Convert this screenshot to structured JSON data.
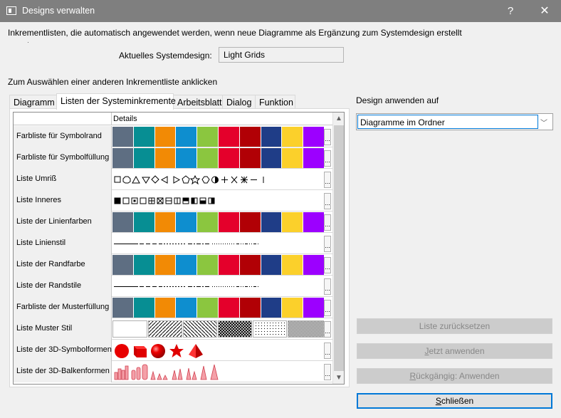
{
  "window": {
    "title": "Designs verwalten",
    "help_glyph": "?",
    "close_glyph": "✕",
    "icon": "window-icon"
  },
  "intro": "Inkrementlisten, die automatisch angewendet werden, wenn neue Diagramme als Ergänzung zum Systemdesign erstellt",
  "intro_mark": "·",
  "system_design": {
    "label": "Aktuelles Systemdesign:",
    "value": "Light Grids"
  },
  "hint": "Zum Auswählen einer anderen Inkrementliste anklicken",
  "tabs": [
    "Diagramm",
    "Listen der Systeminkremente",
    "Arbeitsblatt",
    "Dialog",
    "Funktion"
  ],
  "active_tab": 1,
  "grid": {
    "column_header": "Details",
    "ellipsis": "...",
    "palette": [
      "#5e6e82",
      "#078e93",
      "#f28a05",
      "#0e8ecf",
      "#8bc63f",
      "#e4002b",
      "#b10005",
      "#1f3d87",
      "#fbd02b",
      "#9c00ff"
    ],
    "rows": [
      "Farbliste für Symbolrand",
      "Farbliste für Symbolfüllung",
      "Liste Umriß",
      "Liste Inneres",
      "Liste der Linienfarben",
      "Liste Linienstil",
      "Liste der Randfarbe",
      "Liste der Randstile",
      "Farbliste der Musterfüllung",
      "Liste Muster Stil",
      "Liste der 3D-Symbolformen",
      "Liste der 3D-Balkenformen"
    ]
  },
  "scroll": {
    "up": "▲",
    "down": "▼"
  },
  "apply": {
    "label": "Design anwenden auf",
    "selected": "Diagramme im Ordner",
    "arrow": "﹀"
  },
  "buttons": {
    "reset": "Liste zurücksetzen",
    "apply_now_u": "J",
    "apply_now_rest": "etzt anwenden",
    "undo_u": "R",
    "undo_rest": "ückgängig: Anwenden",
    "close_u": "S",
    "close_rest": "chließen"
  }
}
